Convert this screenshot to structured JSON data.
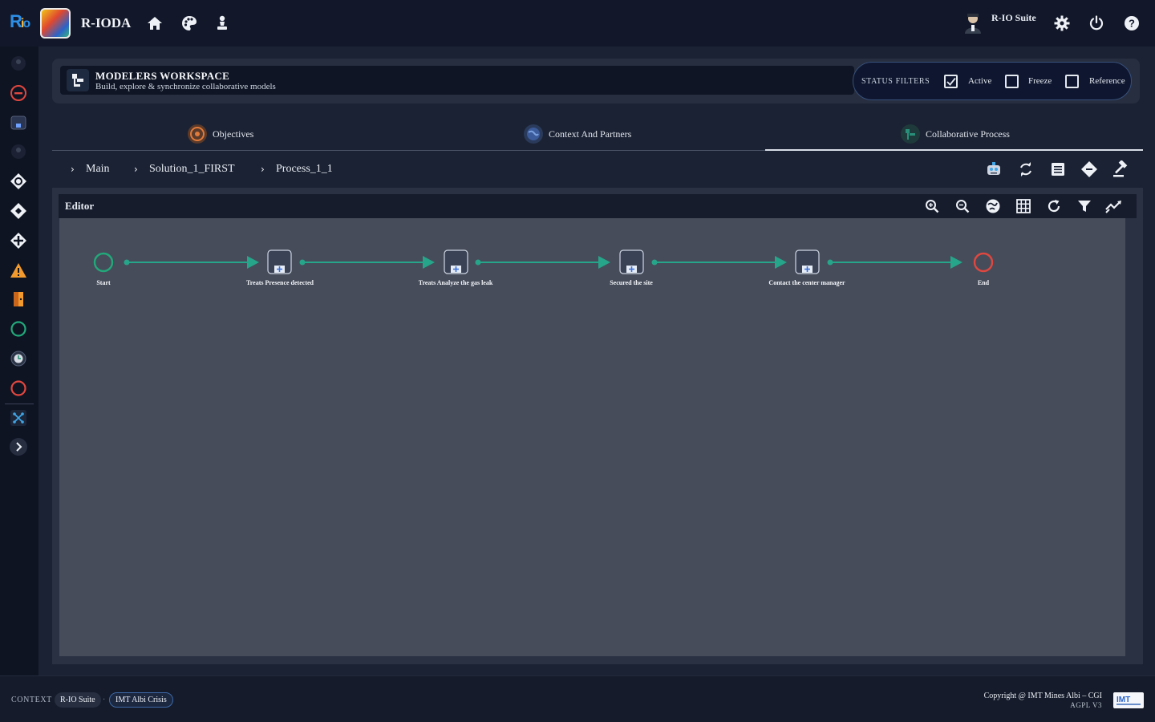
{
  "app": {
    "name": "R-IODA"
  },
  "topbar": {
    "icons": [
      "home-icon",
      "palette-icon",
      "chess-pawn-icon"
    ],
    "user": {
      "name": "R-IO Suite"
    },
    "right_icons": [
      "settings-icon",
      "power-icon",
      "help-icon"
    ]
  },
  "workspace": {
    "title": "MODELERS WORKSPACE",
    "subtitle": "Build, explore & synchronize collaborative models",
    "status_filters": {
      "label": "STATUS FILTERS",
      "items": [
        {
          "label": "Active",
          "checked": true
        },
        {
          "label": "Freeze",
          "checked": false
        },
        {
          "label": "Reference",
          "checked": false
        }
      ]
    }
  },
  "tabs": [
    {
      "label": "Objectives",
      "icon": "target-icon",
      "active": false
    },
    {
      "label": "Context And Partners",
      "icon": "globe-icon",
      "active": false
    },
    {
      "label": "Collaborative Process",
      "icon": "process-icon",
      "active": true
    }
  ],
  "breadcrumb": [
    "Main",
    "Solution_1_FIRST",
    "Process_1_1"
  ],
  "editor": {
    "title": "Editor",
    "nodes": [
      {
        "type": "start",
        "label": "Start"
      },
      {
        "type": "task",
        "label": "Treats Presence detected"
      },
      {
        "type": "task",
        "label": "Treats Analyze the gas leak"
      },
      {
        "type": "task",
        "label": "Secured the site"
      },
      {
        "type": "task",
        "label": "Contact the center manager"
      },
      {
        "type": "end",
        "label": "End"
      }
    ]
  },
  "colors": {
    "accent": "#26a58a",
    "end": "#e0473f",
    "start": "#22a97a"
  },
  "footer": {
    "context_label": "CONTEXT",
    "chips": [
      "R-IO Suite",
      "IMT Albi Crisis"
    ],
    "copyright": "Copyright @ IMT Mines Albi – CGI",
    "license": "AGPL V3"
  }
}
